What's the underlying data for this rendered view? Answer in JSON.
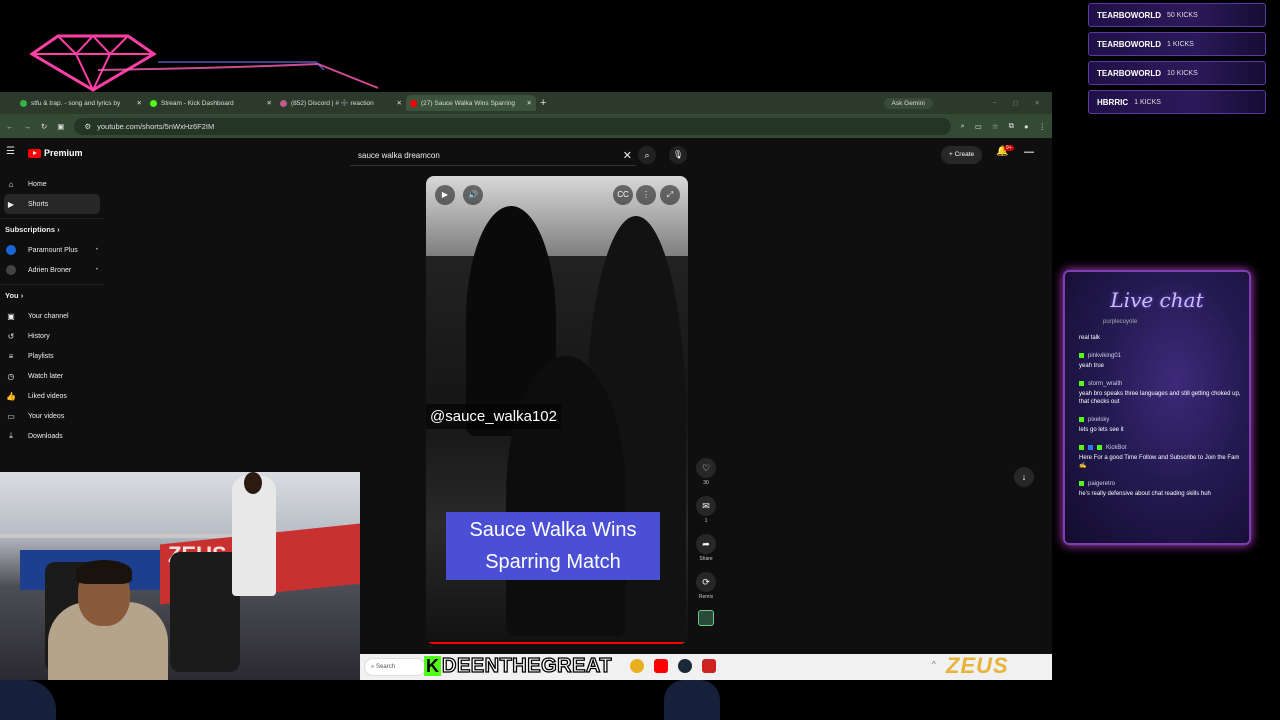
{
  "overlay": {
    "kicks": [
      {
        "user": "TEARBOWORLD",
        "amount": "50 KICKS"
      },
      {
        "user": "TEARBOWORLD",
        "amount": "1 KICKS"
      },
      {
        "user": "TEARBOWORLD",
        "amount": "10 KICKS"
      },
      {
        "user": "HBRRIC",
        "amount": "1 KICKS"
      }
    ],
    "colors": {
      "accent_purple": "#7a3fb0",
      "kick_green": "#53fc18",
      "neon_pink": "#ff3fa6"
    }
  },
  "browser": {
    "tabs": [
      {
        "title": "stfu & trap. - song and lyrics by",
        "favicon": "chrome-icon",
        "color": "#33b34a"
      },
      {
        "title": "Stream - Kick Dashboard",
        "favicon": "kick-icon",
        "color": "#53fc18"
      },
      {
        "title": "(852) Discord | # ➕ reaction",
        "favicon": "discord-icon",
        "color": "#c25a8a"
      },
      {
        "title": "(27) Sauce Walka Wins Sparring",
        "favicon": "youtube-icon",
        "color": "#ff0000"
      }
    ],
    "ask_gemini": "Ask Gemini",
    "url": "youtube.com/shorts/5nWxHz6F2IM"
  },
  "youtube": {
    "logo_label": "Premium",
    "search_value": "sauce walka dreamcon",
    "create_label": "Create",
    "notif_count": "9+",
    "sidebar": {
      "main": [
        {
          "label": "Home",
          "icon": "home-icon"
        },
        {
          "label": "Shorts",
          "icon": "shorts-icon",
          "active": true
        }
      ],
      "subscriptions_heading": "Subscriptions",
      "subscriptions": [
        {
          "label": "Paramount Plus",
          "color": "#1a66d8"
        },
        {
          "label": "Adrien Broner",
          "color": "#444"
        }
      ],
      "you_heading": "You",
      "you_items": [
        {
          "label": "Your channel",
          "icon": "channel-icon"
        },
        {
          "label": "History",
          "icon": "history-icon"
        },
        {
          "label": "Playlists",
          "icon": "playlists-icon"
        },
        {
          "label": "Watch later",
          "icon": "watch-later-icon"
        },
        {
          "label": "Liked videos",
          "icon": "liked-icon"
        },
        {
          "label": "Your videos",
          "icon": "videos-icon"
        },
        {
          "label": "Downloads",
          "icon": "downloads-icon"
        }
      ]
    },
    "short": {
      "handle": "@sauce_walka102",
      "caption_line1": "Sauce Walka Wins",
      "caption_line2": "Sparring Match",
      "progress": 0.98
    },
    "actions": {
      "likes": "30",
      "comments": "1",
      "share": "Share",
      "remix": "Remix"
    }
  },
  "taskbar": {
    "search_placeholder": "Search",
    "streamer_name": "DEENTHEGREAT",
    "sponsor": "ZEUS"
  },
  "chat": {
    "title": "Live chat",
    "cut_user": "purplecoyote",
    "messages": [
      {
        "user": "",
        "text": "real talk"
      },
      {
        "user": "pinkviking01",
        "text": "yeah true"
      },
      {
        "user": "storm_wraith",
        "text": "yeah bro speaks three languages and still getting choked up, that checks out"
      },
      {
        "user": "pixelsky",
        "text": "lets go lets see it"
      },
      {
        "user": "KickBot",
        "text": "Here For a good Time Follow and Subscribe to Join the Fam ✍"
      },
      {
        "user": "paigeretro",
        "text": "he's really defensive about chat reading skills huh"
      }
    ]
  }
}
